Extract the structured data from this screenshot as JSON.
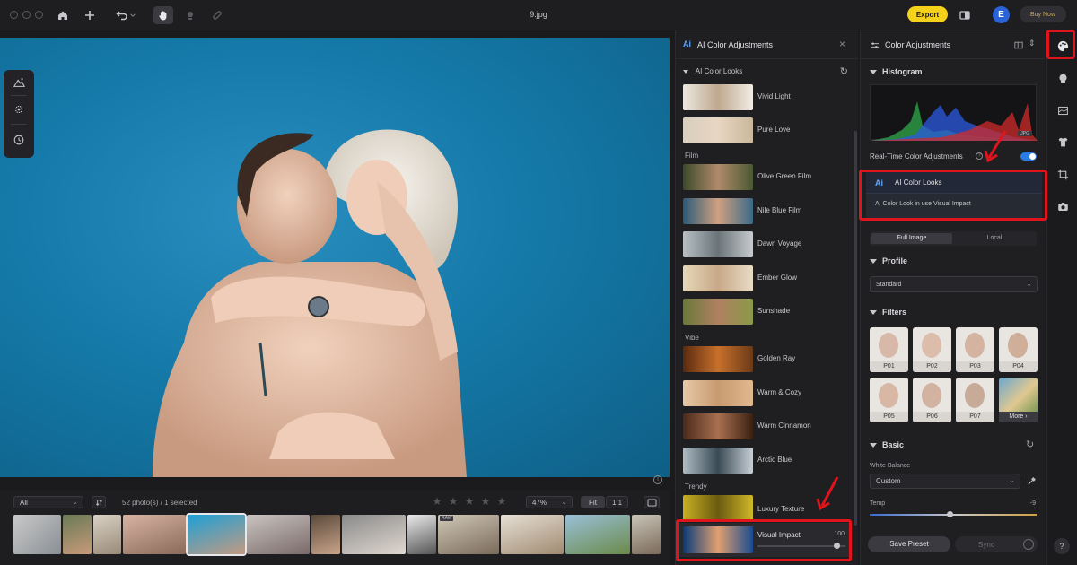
{
  "window": {
    "title": "9.jpg"
  },
  "toolbar": {
    "export_label": "Export",
    "avatar_letter": "E",
    "buy_label": "Buy Now"
  },
  "filmstrip": {
    "filter_value": "All",
    "count_text": "52 photo(s) / 1 selected",
    "zoom_value": "47%",
    "fit_label": "Fit",
    "one_to_one_label": "1:1",
    "raw_badge": "RAW"
  },
  "ai_panel": {
    "title": "AI Color Adjustments",
    "section_label": "AI Color Looks",
    "groups": {
      "film": "Film",
      "vibe": "Vibe",
      "trendy": "Trendy"
    },
    "looks": [
      {
        "label": "Vivid Light"
      },
      {
        "label": "Pure Love"
      },
      {
        "label": "Olive Green Film"
      },
      {
        "label": "Nile Blue Film"
      },
      {
        "label": "Dawn Voyage"
      },
      {
        "label": "Ember Glow"
      },
      {
        "label": "Sunshade"
      },
      {
        "label": "Golden Ray"
      },
      {
        "label": "Warm & Cozy"
      },
      {
        "label": "Warm Cinnamon"
      },
      {
        "label": "Arctic Blue"
      },
      {
        "label": "Luxury Texture"
      }
    ],
    "selected": {
      "label": "Visual Impact",
      "value": "100",
      "fraction": 0.9
    }
  },
  "color_panel": {
    "title": "Color Adjustments",
    "histogram_label": "Histogram",
    "histogram_badge": "JPG",
    "realtime_label": "Real-Time Color Adjustments",
    "ai_box": {
      "icon_text": "Ai",
      "title": "AI Color Looks",
      "subtitle": "AI Color Look in use Visual Impact"
    },
    "tabs": {
      "full": "Full Image",
      "local": "Local"
    },
    "profile": {
      "label": "Profile",
      "value": "Standard"
    },
    "filters": {
      "label": "Filters",
      "items": [
        "P01",
        "P02",
        "P03",
        "P04",
        "P05",
        "P06",
        "P07"
      ],
      "more_label": "More"
    },
    "basic": {
      "label": "Basic",
      "white_balance_label": "White Balance",
      "white_balance_value": "Custom",
      "temp_label": "Temp",
      "temp_value": "-9",
      "temp_fraction": 0.48
    },
    "save_preset_label": "Save Preset",
    "sync_label": "Sync"
  },
  "rail": {
    "help_label": "?"
  },
  "colors": {
    "accent": "#f4d11a",
    "toggle": "#2a7be4",
    "annotation": "#e0141c",
    "panel": "#1f1f22"
  }
}
